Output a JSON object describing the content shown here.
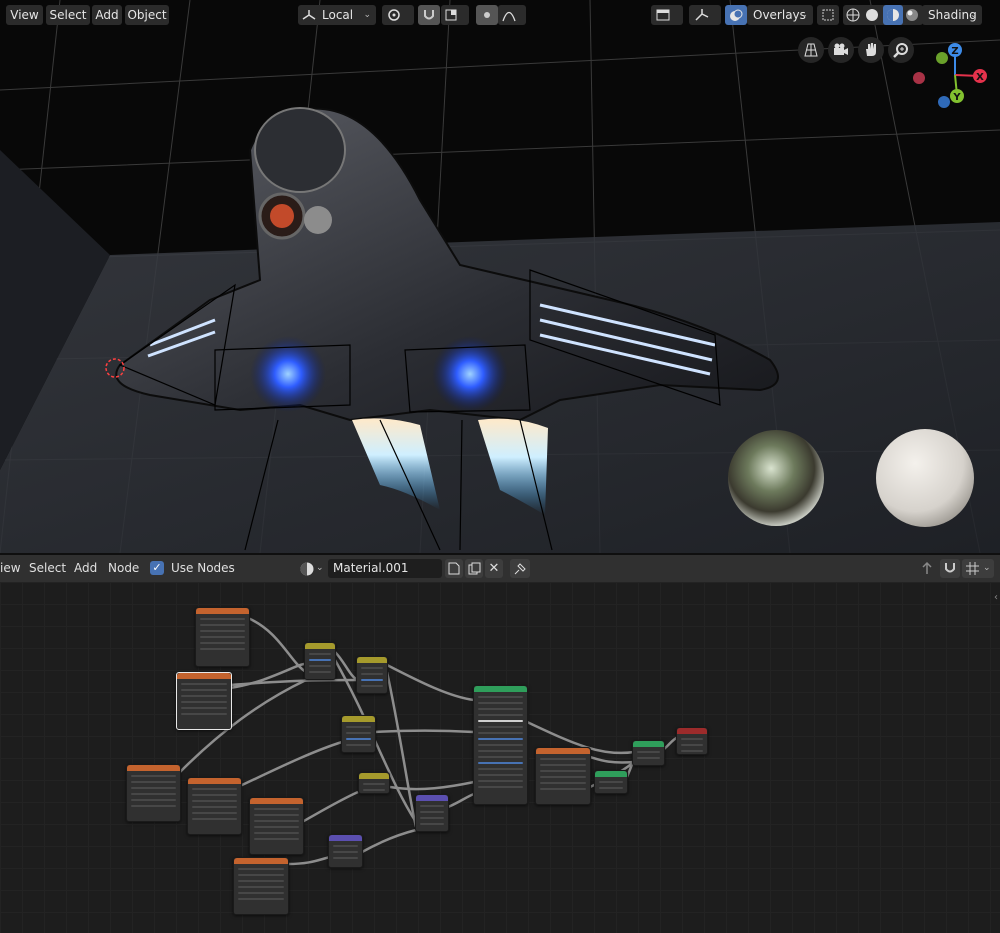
{
  "viewport_header": {
    "menu": [
      "View",
      "Select",
      "Add",
      "Object"
    ],
    "transform_orientation": "Local",
    "overlays_label": "Overlays",
    "shading_label": "Shading"
  },
  "nav_gizmo": {
    "z_label": "Z",
    "x_label": "X",
    "y_label": "Y",
    "colors": {
      "x": "#e5324c",
      "y": "#82c12f",
      "z": "#3d8be8"
    }
  },
  "node_header": {
    "menu": [
      "iew",
      "Select",
      "Add",
      "Node"
    ],
    "use_nodes_label": "Use Nodes",
    "use_nodes_checked": true,
    "material_name": "Material.001"
  },
  "colors": {
    "accent": "#4772b3",
    "node_texture": "#c4632e",
    "node_vector": "#a59a2c",
    "node_shader": "#2f9e5b",
    "node_converter": "#5b4fb0",
    "node_output": "#9c2b2b"
  }
}
